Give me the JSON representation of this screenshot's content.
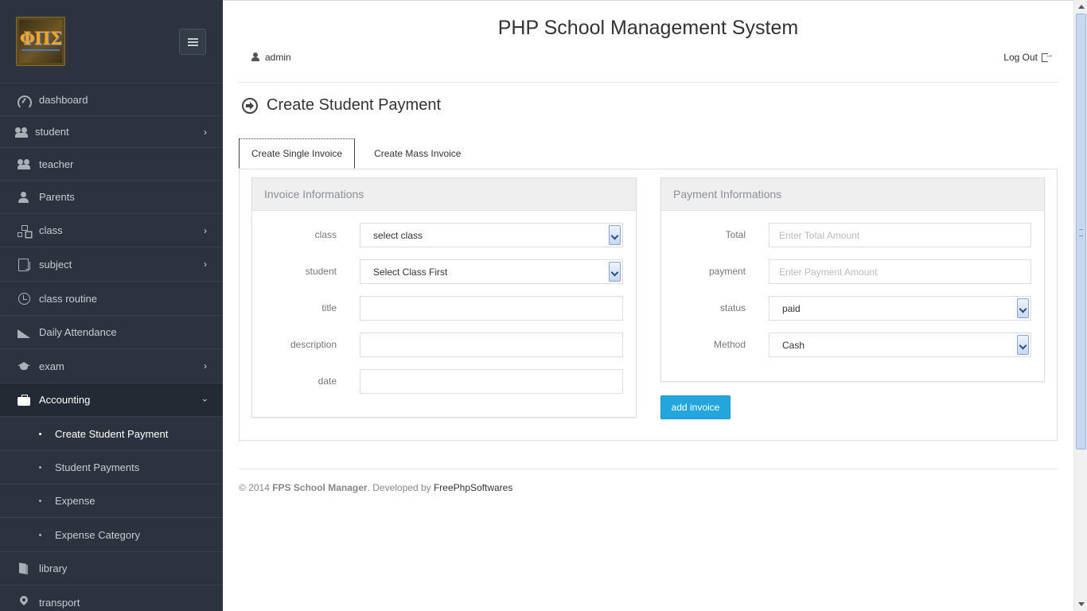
{
  "app_title": "PHP School Management System",
  "user": {
    "name": "admin",
    "logout_label": "Log Out"
  },
  "sidebar": {
    "logo_text": "ΦΠΣ",
    "items": [
      {
        "label": "dashboard",
        "icon": "dashboard-icon"
      },
      {
        "label": "student",
        "icon": "users-icon"
      },
      {
        "label": "teacher",
        "icon": "teacher-icon"
      },
      {
        "label": "Parents",
        "icon": "user-icon"
      },
      {
        "label": "class",
        "icon": "sitemap-icon"
      },
      {
        "label": "subject",
        "icon": "book-icon"
      },
      {
        "label": "class routine",
        "icon": "clock-icon"
      },
      {
        "label": "Daily Attendance",
        "icon": "area-chart-icon"
      },
      {
        "label": "exam",
        "icon": "graduation-cap-icon"
      },
      {
        "label": "Accounting",
        "icon": "briefcase-icon"
      },
      {
        "label": "library",
        "icon": "library-icon"
      },
      {
        "label": "transport",
        "icon": "map-pin-icon"
      }
    ],
    "accounting_sub": [
      {
        "label": "Create Student Payment"
      },
      {
        "label": "Student Payments"
      },
      {
        "label": "Expense"
      },
      {
        "label": "Expense Category"
      }
    ]
  },
  "page": {
    "heading": "Create Student Payment",
    "tabs": [
      {
        "label": "Create Single Invoice"
      },
      {
        "label": "Create Mass Invoice"
      }
    ],
    "invoice_panel": {
      "title": "Invoice Informations",
      "fields": [
        {
          "label": "class",
          "value": "select class"
        },
        {
          "label": "student",
          "value": "Select Class First"
        },
        {
          "label": "title",
          "value": ""
        },
        {
          "label": "description",
          "value": ""
        },
        {
          "label": "date",
          "value": ""
        }
      ]
    },
    "payment_panel": {
      "title": "Payment Informations",
      "fields": [
        {
          "label": "Total",
          "placeholder": "Enter Total Amount"
        },
        {
          "label": "payment",
          "placeholder": "Enter Payment Amount"
        },
        {
          "label": "status",
          "value": "paid"
        },
        {
          "label": "Method",
          "value": "Cash"
        }
      ]
    },
    "add_button": "add invoice"
  },
  "footer": {
    "copyright": "© 2014 ",
    "brand": "FPS School Manager",
    "developed_by": ". Developed by ",
    "developer": "FreePhpSoftwares"
  },
  "colors": {
    "sidebar_bg": "#2c333e",
    "accent": "#23a6dd"
  }
}
